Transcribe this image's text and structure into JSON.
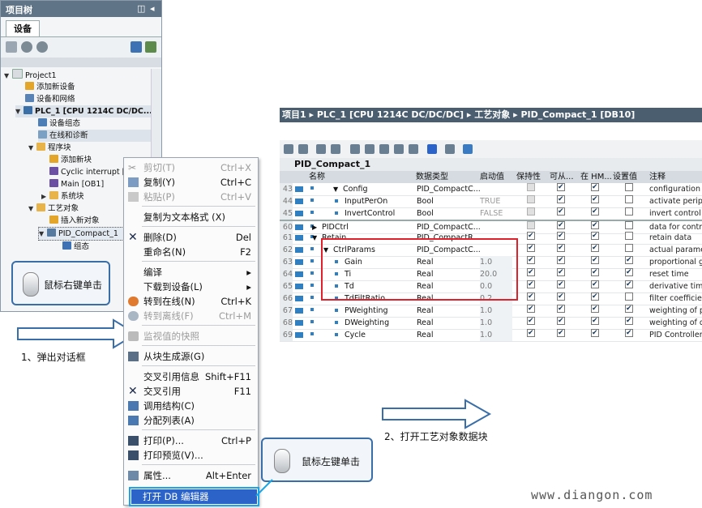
{
  "tree": {
    "title": "项目树",
    "tab": "设备",
    "items": [
      {
        "label": "Project1"
      },
      {
        "label": "添加新设备"
      },
      {
        "label": "设备和网络"
      },
      {
        "label": "PLC_1 [CPU 1214C DC/DC..."
      },
      {
        "label": "设备组态"
      },
      {
        "label": "在线和诊断"
      },
      {
        "label": "程序块"
      },
      {
        "label": "添加新块"
      },
      {
        "label": "Cyclic interrupt [O"
      },
      {
        "label": "Main [OB1]"
      },
      {
        "label": "系统块"
      },
      {
        "label": "工艺对象"
      },
      {
        "label": "插入新对象"
      },
      {
        "label": "PID_Compact_1"
      },
      {
        "label": "组态"
      }
    ]
  },
  "callouts": {
    "right_click": "鼠标右键单击",
    "left_click": "鼠标左键单击",
    "step1": "1、弹出对话框",
    "step2": "2、打开工艺对象数据块"
  },
  "context_menu": {
    "items": [
      {
        "label": "剪切(T)",
        "shortcut": "Ctrl+X",
        "disabled": true
      },
      {
        "label": "复制(Y)",
        "shortcut": "Ctrl+C",
        "disabled": false
      },
      {
        "label": "粘贴(P)",
        "shortcut": "Ctrl+V",
        "disabled": true
      },
      {
        "label": "复制为文本格式 (X)",
        "shortcut": "",
        "disabled": false
      },
      {
        "label": "删除(D)",
        "shortcut": "Del",
        "disabled": false
      },
      {
        "label": "重命名(N)",
        "shortcut": "F2",
        "disabled": false
      },
      {
        "label": "编译",
        "shortcut": "",
        "disabled": false
      },
      {
        "label": "下载到设备(L)",
        "shortcut": "",
        "disabled": false
      },
      {
        "label": "转到在线(N)",
        "shortcut": "Ctrl+K",
        "disabled": false
      },
      {
        "label": "转到离线(F)",
        "shortcut": "Ctrl+M",
        "disabled": true
      },
      {
        "label": "监视值的快照",
        "shortcut": "",
        "disabled": true
      },
      {
        "label": "从块生成源(G)",
        "shortcut": "",
        "disabled": false
      },
      {
        "label": "交叉引用信息",
        "shortcut": "Shift+F11",
        "disabled": false
      },
      {
        "label": "交叉引用",
        "shortcut": "F11",
        "disabled": false
      },
      {
        "label": "调用结构(C)",
        "shortcut": "",
        "disabled": false
      },
      {
        "label": "分配列表(A)",
        "shortcut": "",
        "disabled": false
      },
      {
        "label": "打印(P)...",
        "shortcut": "Ctrl+P",
        "disabled": false
      },
      {
        "label": "打印预览(V)...",
        "shortcut": "",
        "disabled": false
      },
      {
        "label": "属性...",
        "shortcut": "Alt+Enter",
        "disabled": false
      },
      {
        "label": "打开 DB 编辑器",
        "shortcut": "",
        "disabled": false
      }
    ]
  },
  "db_editor": {
    "breadcrumb": "项目1 ▸ PLC_1 [CPU 1214C DC/DC/DC] ▸ 工艺对象 ▸ PID_Compact_1 [DB10]",
    "block_name": "PID_Compact_1",
    "columns": [
      "名称",
      "数据类型",
      "启动值",
      "保持性",
      "可从...",
      "在 HM...",
      "设置值",
      "注释"
    ],
    "rows": [
      {
        "num": "43",
        "name": "Config",
        "type": "PID_CompactC...",
        "start": "",
        "comment": "configuration d"
      },
      {
        "num": "44",
        "name": "InputPerOn",
        "type": "Bool",
        "start": "TRUE",
        "comment": "activate periph"
      },
      {
        "num": "45",
        "name": "InvertControl",
        "type": "Bool",
        "start": "FALSE",
        "comment": "invert control d"
      },
      {
        "num": "60",
        "name": "PIDCtrl",
        "type": "PID_CompactC...",
        "start": "",
        "comment": "data for contro"
      },
      {
        "num": "61",
        "name": "Retain",
        "type": "PID_CompactR...",
        "start": "",
        "comment": "retain data"
      },
      {
        "num": "62",
        "name": "CtrlParams",
        "type": "PID_CompactC...",
        "start": "",
        "comment": "actual parame"
      },
      {
        "num": "63",
        "name": "Gain",
        "type": "Real",
        "start": "1.0",
        "comment": "proportional ga"
      },
      {
        "num": "64",
        "name": "Ti",
        "type": "Real",
        "start": "20.0",
        "comment": "reset time"
      },
      {
        "num": "65",
        "name": "Td",
        "type": "Real",
        "start": "0.0",
        "comment": "derivative time"
      },
      {
        "num": "66",
        "name": "TdFiltRatio",
        "type": "Real",
        "start": "0.2",
        "comment": "filter coefficient"
      },
      {
        "num": "67",
        "name": "PWeighting",
        "type": "Real",
        "start": "1.0",
        "comment": "weighting of pr"
      },
      {
        "num": "68",
        "name": "DWeighting",
        "type": "Real",
        "start": "1.0",
        "comment": "weighting of de"
      },
      {
        "num": "69",
        "name": "Cycle",
        "type": "Real",
        "start": "1.0",
        "comment": "PID Controller c"
      }
    ]
  },
  "watermark": "www.diangon.com",
  "colors": {
    "tree_title": "#5f7487",
    "menu_selected": "#2b63c8",
    "highlight": "#e0202a",
    "callout_border": "#3a6ea8"
  }
}
